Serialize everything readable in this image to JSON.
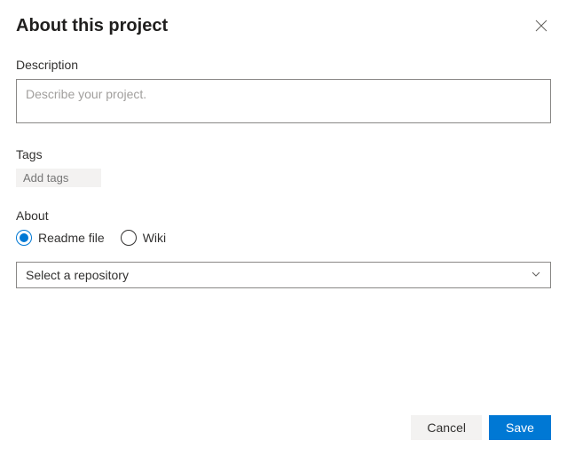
{
  "dialog": {
    "title": "About this project"
  },
  "description": {
    "label": "Description",
    "placeholder": "Describe your project.",
    "value": ""
  },
  "tags": {
    "label": "Tags",
    "placeholder": "Add tags"
  },
  "about": {
    "label": "About",
    "options": {
      "readme": "Readme file",
      "wiki": "Wiki"
    },
    "repository": {
      "placeholder": "Select a repository"
    }
  },
  "footer": {
    "cancel": "Cancel",
    "save": "Save"
  }
}
